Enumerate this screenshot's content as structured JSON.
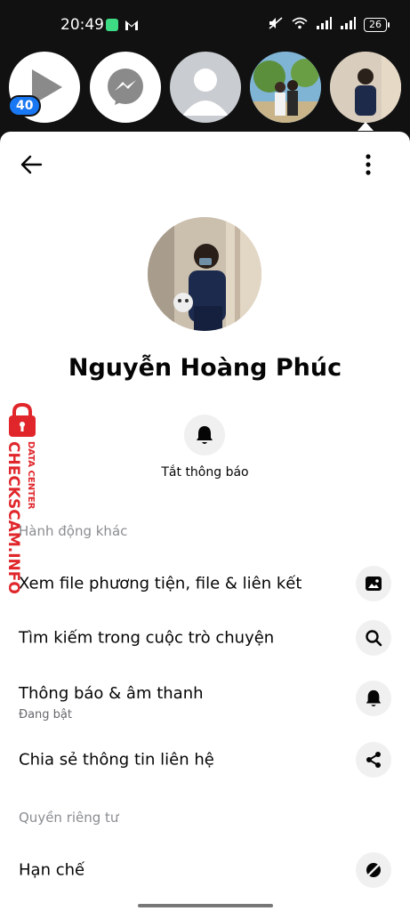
{
  "status_bar": {
    "time": "20:49",
    "battery": "26"
  },
  "chat_heads": {
    "badge_count": "40"
  },
  "profile": {
    "name": "Nguyễn Hoàng Phúc",
    "mute_label": "Tắt thông báo"
  },
  "sections": {
    "other_actions": "Hành động khác",
    "privacy": "Quyền riêng tư"
  },
  "actions": [
    {
      "label": "Xem file phương tiện, file & liên kết",
      "icon": "image-icon"
    },
    {
      "label": "Tìm kiếm trong cuộc trò chuyện",
      "icon": "search-icon"
    },
    {
      "label": "Thông báo & âm thanh",
      "sub": "Đang bật",
      "icon": "bell-icon"
    },
    {
      "label": "Chia sẻ thông tin liên hệ",
      "icon": "share-icon"
    }
  ],
  "privacy_actions": [
    {
      "label": "Hạn chế",
      "icon": "restrict-icon"
    }
  ],
  "watermark": {
    "main": "CHECKSCAM.INFO",
    "sub": "DATA CENTER"
  },
  "colors": {
    "accent": "#1877f2",
    "watermark": "#e0262b",
    "icon_bg": "#f0f0f0",
    "section": "#8a8d91"
  }
}
